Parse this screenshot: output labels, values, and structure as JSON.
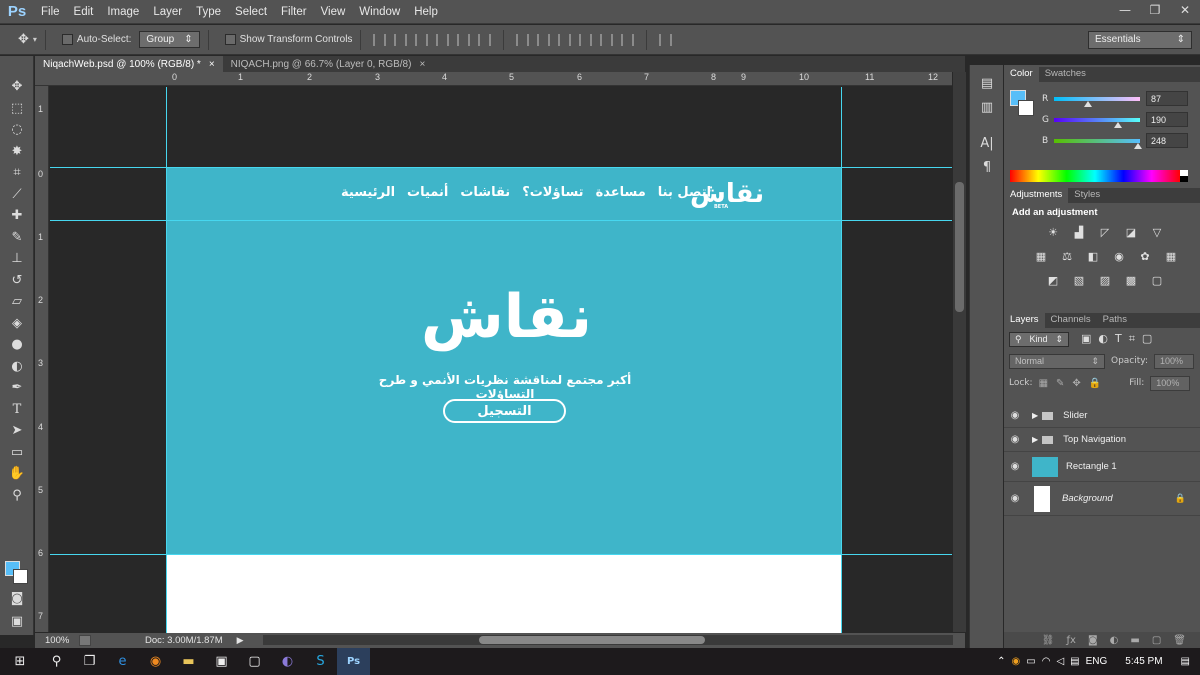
{
  "app": {
    "logo": "Ps",
    "menu": [
      "File",
      "Edit",
      "Image",
      "Layer",
      "Type",
      "Select",
      "Filter",
      "View",
      "Window",
      "Help"
    ],
    "window_controls": [
      "—",
      "❐",
      "✕"
    ]
  },
  "options_bar": {
    "auto_select_label": "Auto-Select:",
    "auto_select_value": "Group",
    "show_transform_label": "Show Transform Controls",
    "workspace": "Essentials"
  },
  "doc_tabs": [
    {
      "label": "NiqachWeb.psd @ 100% (RGB/8) *",
      "close": "×"
    },
    {
      "label": "NIQACH.png @ 66.7% (Layer 0, RGB/8)",
      "close": "×"
    }
  ],
  "rulers": {
    "top": [
      "0",
      "1",
      "2",
      "3",
      "4",
      "5",
      "6",
      "7",
      "8",
      "9",
      "10",
      "11",
      "12"
    ],
    "left": [
      "1",
      "0",
      "1",
      "2",
      "3",
      "4",
      "5",
      "6",
      "7"
    ]
  },
  "website": {
    "nav": [
      "الرئيسية",
      "أنميات",
      "نقاشات",
      "تساؤلات؟",
      "مساعدة",
      "إتصل بنا"
    ],
    "header_logo": "نقاش",
    "header_logo_badge": "BETA",
    "hero_logo": "نقاش",
    "tagline": "أكبر مجتمع لمناقشة نظريات الأنمي و طرح التساؤلات",
    "cta": "التسجيل"
  },
  "status_bar": {
    "zoom": "100%",
    "doc_size": "Doc: 3.00M/1.87M"
  },
  "color_panel": {
    "tabs": [
      "Color",
      "Swatches"
    ],
    "r_label": "R",
    "r": "87",
    "g_label": "G",
    "g": "190",
    "b_label": "B",
    "b": "248",
    "foreground": "#57bef8"
  },
  "adjustments_panel": {
    "tabs": [
      "Adjustments",
      "Styles"
    ],
    "heading": "Add an adjustment"
  },
  "layers_panel": {
    "tabs": [
      "Layers",
      "Channels",
      "Paths"
    ],
    "filter": "Kind",
    "blend_mode": "Normal",
    "opacity_label": "Opacity:",
    "opacity": "100%",
    "lock_label": "Lock:",
    "fill_label": "Fill:",
    "fill": "100%",
    "layers": [
      {
        "name": "Slider",
        "type": "group"
      },
      {
        "name": "Top Navigation",
        "type": "group"
      },
      {
        "name": "Rectangle 1",
        "type": "shape"
      },
      {
        "name": "Background",
        "type": "background"
      }
    ]
  },
  "taskbar": {
    "language": "ENG",
    "time": "5:45 PM"
  },
  "colors": {
    "site_teal": "#3fb5c9",
    "guide": "#47d7ef"
  }
}
